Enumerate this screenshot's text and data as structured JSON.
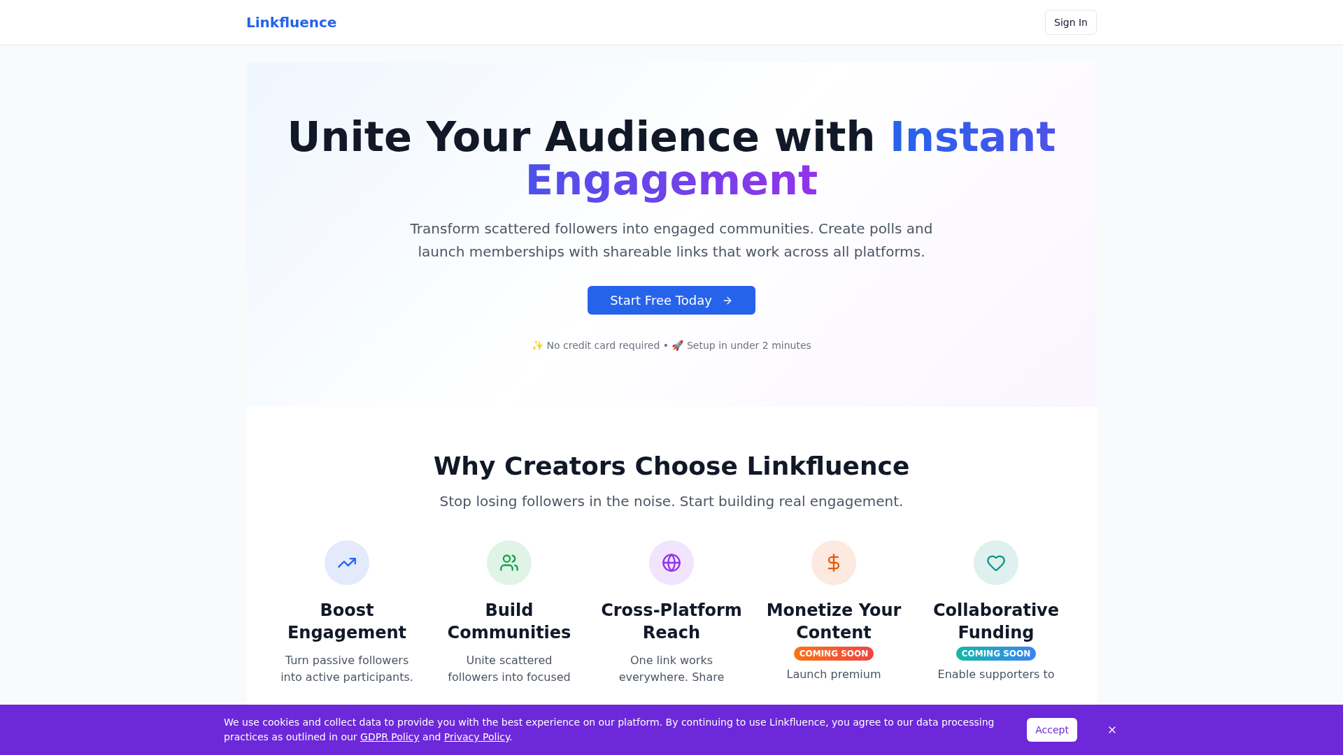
{
  "nav": {
    "logo": "Linkfluence",
    "sign_in": "Sign In"
  },
  "hero": {
    "title": "Unite Your Audience with ",
    "highlight": "Instant Engagement",
    "subtitle": "Transform scattered followers into engaged communities. Create polls and launch memberships with shareable links that work across all platforms.",
    "cta": "Start Free Today",
    "note": "✨ No credit card required • 🚀 Setup in under 2 minutes"
  },
  "why": {
    "title": "Why Creators Choose Linkfluence",
    "subtitle": "Stop losing followers in the noise. Start building real engagement.",
    "features": [
      {
        "kind": "trend",
        "color": "#2563eb",
        "title": "Boost Engagement",
        "description": "Turn passive followers into active participants."
      },
      {
        "kind": "users",
        "color": "#16a34a",
        "title": "Build Communities",
        "description": "Unite scattered followers into focused"
      },
      {
        "kind": "globe",
        "color": "#9333ea",
        "title": "Cross-Platform Reach",
        "description": "One link works everywhere. Share"
      },
      {
        "kind": "dollar",
        "color": "#ea580c",
        "title": "Monetize Your Content",
        "badge": {
          "label": "COMING SOON",
          "kind": "warm"
        },
        "description": "Launch premium"
      },
      {
        "kind": "heart",
        "color": "#0d9488",
        "title": "Collaborative Funding",
        "badge": {
          "label": "COMING SOON",
          "kind": "cool"
        },
        "description": "Enable supporters to"
      }
    ]
  },
  "cookie": {
    "text_before": "We use cookies and collect data to provide you with the best experience on our platform. By continuing to use Linkfluence, you agree to our data processing practices as outlined in our ",
    "link_1": "GDPR Policy",
    "text_between": " and ",
    "link_2": "Privacy Policy",
    "text_after": ".",
    "accept": "Accept"
  }
}
